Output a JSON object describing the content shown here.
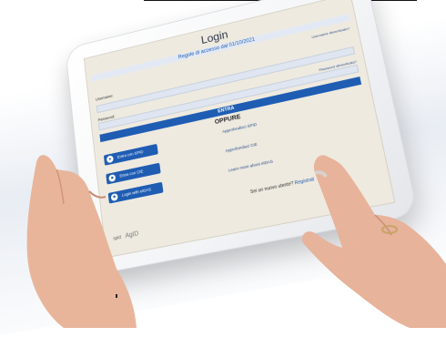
{
  "login": {
    "title": "Login",
    "banner": "Regole di accesso dal 01/10/2021",
    "forgot_username": "Username dimenticato?",
    "username_label": "Username:",
    "forgot_password": "Password dimenticata?",
    "password_label": "Password:",
    "submit_label": "ENTRA",
    "separator": "OPPURE"
  },
  "methods": [
    {
      "label": "Entra con SPID",
      "icon": "spid-icon",
      "link": "Approfondisci SPID"
    },
    {
      "label": "Entra con CIE",
      "icon": "cie-icon",
      "link": "Approfondisci CIE"
    },
    {
      "label": "Login with eIDAS",
      "icon": "eidas-icon",
      "link": "Learn more about eIDAS"
    }
  ],
  "signup": {
    "prompt": "Sei un nuovo utente?",
    "link": "Registrati"
  },
  "footer": {
    "spid_mark": "spid",
    "agid_mark": "AgID"
  },
  "colors": {
    "primary": "#1f5db3",
    "screen_bg": "#eeeae0",
    "skin": "#e7b49b"
  }
}
